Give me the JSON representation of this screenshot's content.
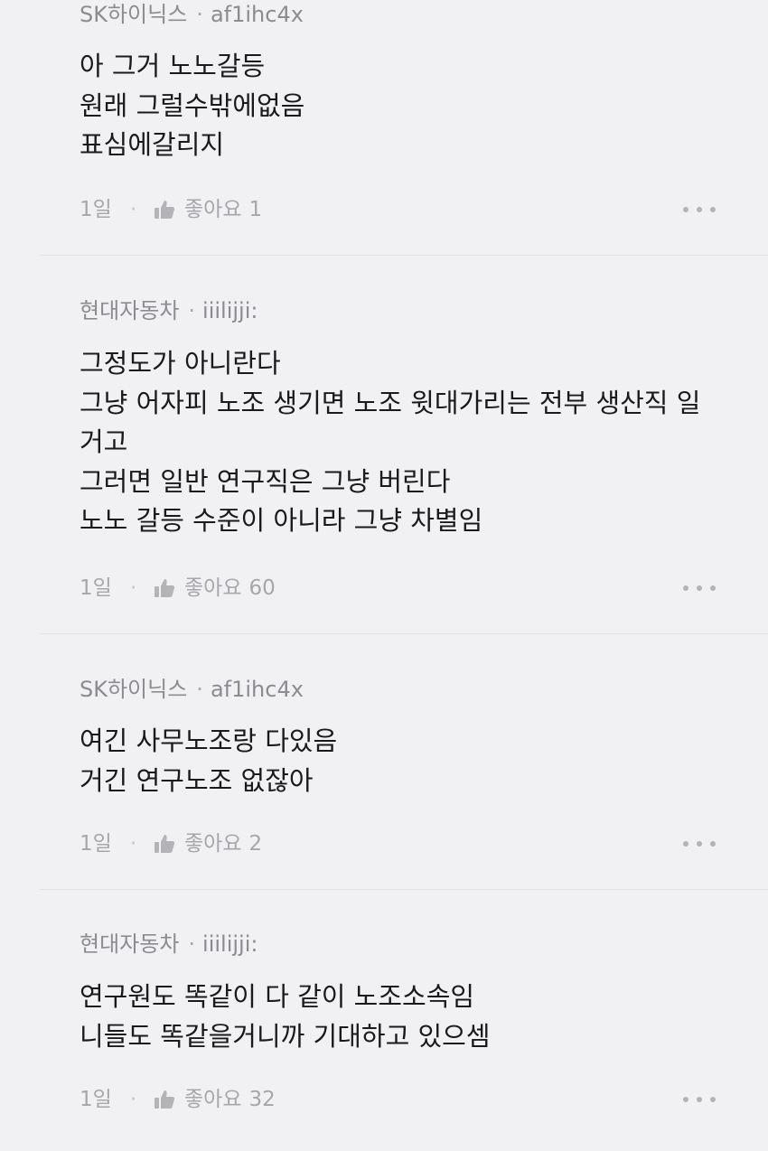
{
  "comments": [
    {
      "company": "SK하이닉스",
      "separator": "·",
      "nickname": "af1ihc4x",
      "lines": [
        "아 그거 노노갈등",
        "원래 그럴수밖에없음",
        "표심에갈리지"
      ],
      "time": "1일",
      "meta_separator": "·",
      "like_label": "좋아요",
      "like_count": "1",
      "like_icon": "thumbs-up-icon",
      "more_icon": "more-dots-icon"
    },
    {
      "company": "현대자동차",
      "separator": "·",
      "nickname": "iiilijji:",
      "lines": [
        "그정도가 아니란다",
        "그냥 어자피 노조 생기면 노조 윗대가리는 전부 생산직 일",
        "거고",
        "그러면 일반 연구직은 그냥 버린다",
        "노노 갈등 수준이 아니라 그냥 차별임"
      ],
      "time": "1일",
      "meta_separator": "·",
      "like_label": "좋아요",
      "like_count": "60",
      "like_icon": "thumbs-up-icon",
      "more_icon": "more-dots-icon"
    },
    {
      "company": "SK하이닉스",
      "separator": "·",
      "nickname": "af1ihc4x",
      "lines": [
        "여긴 사무노조랑 다있음",
        "거긴 연구노조 없잖아"
      ],
      "time": "1일",
      "meta_separator": "·",
      "like_label": "좋아요",
      "like_count": "2",
      "like_icon": "thumbs-up-icon",
      "more_icon": "more-dots-icon"
    },
    {
      "company": "현대자동차",
      "separator": "·",
      "nickname": "iiilijji:",
      "lines": [
        "연구원도 똑같이 다 같이 노조소속임",
        "니들도 똑같을거니까 기대하고 있으셈"
      ],
      "time": "1일",
      "meta_separator": "·",
      "like_label": "좋아요",
      "like_count": "32",
      "like_icon": "thumbs-up-icon",
      "more_icon": "more-dots-icon"
    }
  ]
}
